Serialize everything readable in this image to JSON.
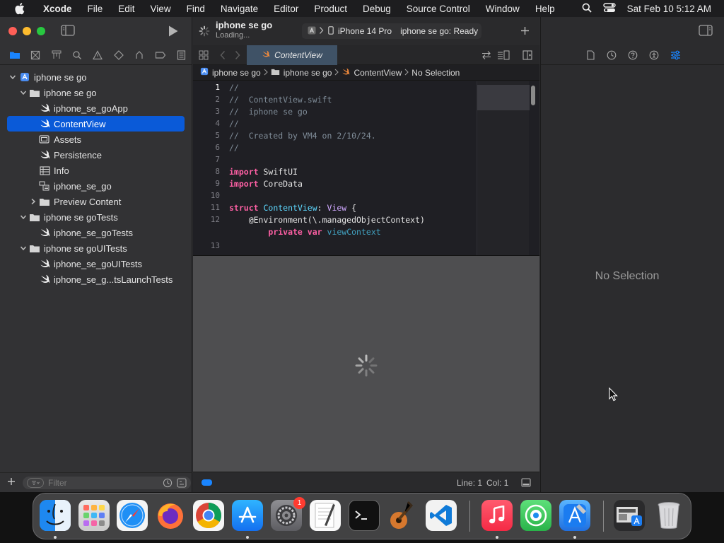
{
  "menubar": {
    "app_name": "Xcode",
    "items": [
      "File",
      "Edit",
      "View",
      "Find",
      "Navigate",
      "Editor",
      "Product",
      "Debug",
      "Source Control",
      "Window",
      "Help"
    ],
    "datetime": "Sat Feb 10  5:12 AM"
  },
  "toolbar": {
    "scheme_title": "iphone se go",
    "scheme_status": "Loading...",
    "device": "iPhone 14 Pro",
    "activity": "iphone se go: Ready"
  },
  "tab": {
    "active_label": "ContentView"
  },
  "jumpbar": {
    "crumbs": [
      "iphone se go",
      "iphone se go",
      "ContentView",
      "No Selection"
    ]
  },
  "navigator": {
    "tree": [
      {
        "label": "iphone se go",
        "kind": "project",
        "expanded": true
      },
      {
        "label": "iphone se go",
        "kind": "folder",
        "expanded": true
      },
      {
        "label": "iphone_se_goApp",
        "kind": "swift"
      },
      {
        "label": "ContentView",
        "kind": "swift",
        "selected": true
      },
      {
        "label": "Assets",
        "kind": "assets"
      },
      {
        "label": "Persistence",
        "kind": "swift"
      },
      {
        "label": "Info",
        "kind": "plist"
      },
      {
        "label": "iphone_se_go",
        "kind": "datamodel"
      },
      {
        "label": "Preview Content",
        "kind": "folder",
        "expanded": false
      },
      {
        "label": "iphone se goTests",
        "kind": "folder",
        "expanded": true
      },
      {
        "label": "iphone_se_goTests",
        "kind": "swift"
      },
      {
        "label": "iphone se goUITests",
        "kind": "folder",
        "expanded": true
      },
      {
        "label": "iphone_se_goUITests",
        "kind": "swift"
      },
      {
        "label": "iphone_se_g...tsLaunchTests",
        "kind": "swift"
      }
    ],
    "filter_placeholder": "Filter"
  },
  "code": {
    "lines": [
      {
        "n": "1",
        "t": "//"
      },
      {
        "n": "2",
        "t": "//  ContentView.swift"
      },
      {
        "n": "3",
        "t": "//  iphone se go"
      },
      {
        "n": "4",
        "t": "//"
      },
      {
        "n": "5",
        "t": "//  Created by VM4 on 2/10/24."
      },
      {
        "n": "6",
        "t": "//"
      },
      {
        "n": "7",
        "t": ""
      },
      {
        "n": "8",
        "t": "import SwiftUI"
      },
      {
        "n": "9",
        "t": "import CoreData"
      },
      {
        "n": "10",
        "t": ""
      },
      {
        "n": "11",
        "t": "struct ContentView: View {"
      },
      {
        "n": "12",
        "t": "    @Environment(\\.managedObjectContext)"
      },
      {
        "n": "",
        "t": "        private var viewContext"
      },
      {
        "n": "13",
        "t": ""
      }
    ]
  },
  "status": {
    "line": "Line: 1",
    "col": "Col: 1"
  },
  "inspector": {
    "no_selection": "No Selection"
  },
  "dock": {
    "settings_badge": "1"
  },
  "colors": {
    "accent": "#0a5ad8",
    "comment": "#7f8c98",
    "keyword": "#fc5fa3",
    "type_decl": "#5dd8ff",
    "type_ref": "#d0a8ff",
    "property": "#41a1c0"
  }
}
